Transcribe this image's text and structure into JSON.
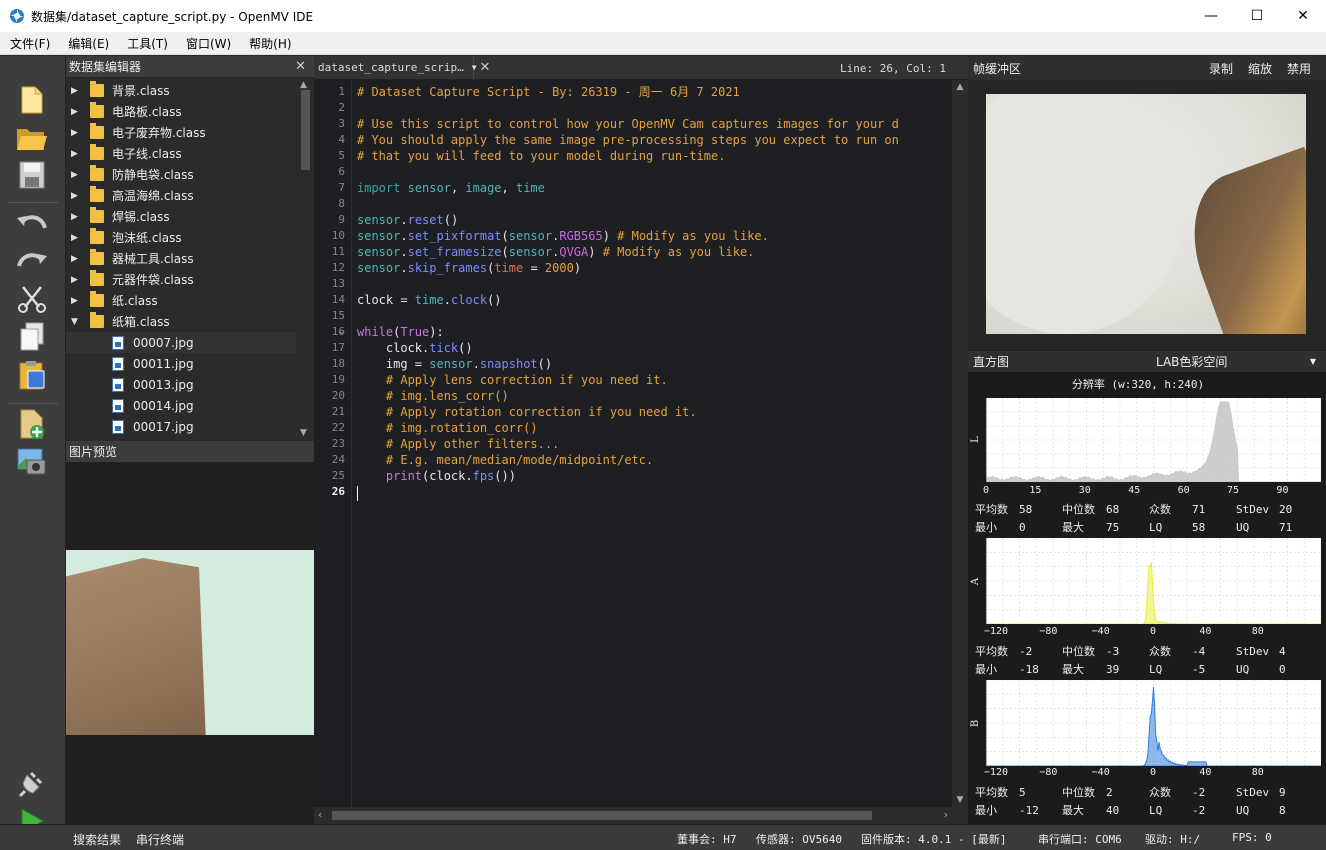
{
  "window": {
    "title": "数据集/dataset_capture_script.py - OpenMV IDE",
    "controls": [
      "—",
      "☐",
      "✕"
    ]
  },
  "menu": [
    "文件(F)",
    "编辑(E)",
    "工具(T)",
    "窗口(W)",
    "帮助(H)"
  ],
  "toolbar": {
    "icons": [
      "new-file-icon",
      "open-folder-icon",
      "save-icon",
      "undo-icon",
      "redo-icon",
      "cut-icon",
      "copy-icon",
      "paste-icon",
      "new-dataset-class-icon",
      "capture-image-icon",
      "connect-icon",
      "run-icon"
    ]
  },
  "dataset_editor": {
    "title": "数据集编辑器",
    "folders": [
      {
        "name": "背景.class",
        "expanded": false
      },
      {
        "name": "电路板.class",
        "expanded": false
      },
      {
        "name": "电子废弃物.class",
        "expanded": false
      },
      {
        "name": "电子线.class",
        "expanded": false
      },
      {
        "name": "防静电袋.class",
        "expanded": false
      },
      {
        "name": "高温海绵.class",
        "expanded": false
      },
      {
        "name": "焊锡.class",
        "expanded": false
      },
      {
        "name": "泡沫纸.class",
        "expanded": false
      },
      {
        "name": "器械工具.class",
        "expanded": false
      },
      {
        "name": "元器件袋.class",
        "expanded": false
      },
      {
        "name": "纸.class",
        "expanded": false
      },
      {
        "name": "纸箱.class",
        "expanded": true
      }
    ],
    "files": [
      "00007.jpg",
      "00011.jpg",
      "00013.jpg",
      "00014.jpg",
      "00017.jpg"
    ]
  },
  "image_preview": {
    "title": "图片预览"
  },
  "editor": {
    "tab_name": "dataset_capture_scrip…",
    "cursor_position": "Line: 26, Col: 1",
    "line_count": 26,
    "current_line": 26,
    "lines": [
      "# Dataset Capture Script - By: 26319 - 周一 6月 7 2021",
      "",
      "# Use this script to control how your OpenMV Cam captures images for your d",
      "# You should apply the same image pre-processing steps you expect to run on",
      "# that you will feed to your model during run-time.",
      "",
      "import sensor, image, time",
      "",
      "sensor.reset()",
      "sensor.set_pixformat(sensor.RGB565) # Modify as you like.",
      "sensor.set_framesize(sensor.QVGA) # Modify as you like.",
      "sensor.skip_frames(time = 2000)",
      "",
      "clock = time.clock()",
      "",
      "while(True):",
      "    clock.tick()",
      "    img = sensor.snapshot()",
      "    # Apply lens correction if you need it.",
      "    # img.lens_corr()",
      "    # Apply rotation correction if you need it.",
      "    # img.rotation_corr()",
      "    # Apply other filters...",
      "    # E.g. mean/median/mode/midpoint/etc.",
      "    print(clock.fps())",
      ""
    ]
  },
  "frame_buffer": {
    "title": "帧缓冲区",
    "actions": [
      "录制",
      "缩放",
      "禁用"
    ]
  },
  "histogram": {
    "title": "直方图",
    "color_space": "LAB色彩空间",
    "resolution": "分辨率 (w:320, h:240)",
    "stat_labels": {
      "mean": "平均数",
      "median": "中位数",
      "mode": "众数",
      "stdev": "StDev",
      "min": "最小",
      "max": "最大",
      "lq": "LQ",
      "uq": "UQ"
    },
    "channels": [
      {
        "name": "L",
        "color": "#c8c8c8",
        "ticks": [
          "0",
          "15",
          "30",
          "45",
          "60",
          "75",
          "90"
        ],
        "stats": {
          "mean": "58",
          "median": "68",
          "mode": "71",
          "stdev": "20",
          "min": "0",
          "max": "75",
          "lq": "58",
          "uq": "71"
        }
      },
      {
        "name": "A",
        "color": "#e8ee3a",
        "ticks": [
          "−120",
          "−80",
          "−40",
          "0",
          "40",
          "80"
        ],
        "stats": {
          "mean": "-2",
          "median": "-3",
          "mode": "-4",
          "stdev": "4",
          "min": "-18",
          "max": "39",
          "lq": "-5",
          "uq": "0"
        }
      },
      {
        "name": "B",
        "color": "#2f7fe0",
        "ticks": [
          "−120",
          "−80",
          "−40",
          "0",
          "40",
          "80"
        ],
        "stats": {
          "mean": "5",
          "median": "2",
          "mode": "-2",
          "stdev": "9",
          "min": "-12",
          "max": "40",
          "lq": "-2",
          "uq": "8"
        }
      }
    ]
  },
  "statusbar": {
    "tab_search": "搜索结果",
    "tab_serial": "串行终端",
    "board": "董事会: H7",
    "sensor": "传感器: OV5640",
    "firmware": "固件版本: 4.0.1 - [最新]",
    "serial_port": "串行端口: COM6",
    "drive": "驱动: H:/",
    "fps": "FPS: 0"
  }
}
